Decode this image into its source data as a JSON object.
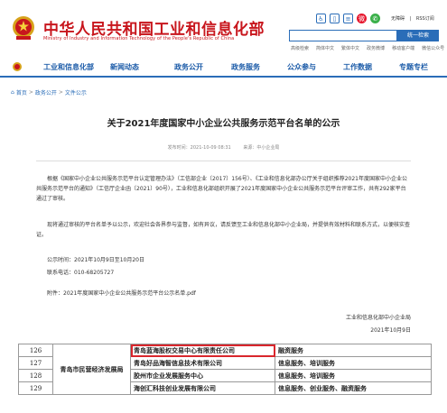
{
  "header": {
    "site_title": "中华人民共和国工业和信息化部",
    "site_subtitle": "Ministry of Industry and Information Technology of the People's Republic of China",
    "top_links": [
      "无障碍",
      "|",
      "RSS订阅"
    ],
    "search_placeholder": "",
    "search_button": "统一检索",
    "quick_links": [
      "高级检索",
      "简体中文",
      "繁体中文",
      "政务微博",
      "移动客户端",
      "微信公众号"
    ],
    "icons": [
      "accessibility-icon",
      "mobile-icon",
      "feed-icon",
      "weibo-icon",
      "wechat-icon"
    ]
  },
  "nav": {
    "items": [
      "工业和信息化部",
      "新闻动态",
      "政务公开",
      "政务服务",
      "公众参与",
      "工作数据",
      "专题专栏"
    ]
  },
  "breadcrumb": [
    "首页",
    ">",
    "政务公开",
    ">",
    "文件公示"
  ],
  "article": {
    "title": "关于2021年度国家中小企业公共服务示范平台名单的公示",
    "publish_time": "发布时间：2021-10-09 08:31",
    "source": "来源：中小企业局",
    "paragraphs": [
      "根据《国家中小企业公共服务示范平台认定管理办法》（工信部企业〔2017〕156号）、《工业和信息化部办公厅关于组织推荐2021年度国家中小企业公共服务示范平台的通知》（工信厅企业函〔2021〕90号），工业和信息化部组织开展了2021年度国家中小企业公共服务示范平台评审工作，共有292家平台通过了审核。",
      "现将通过审核的平台名单予以公示，欢迎社会各界参与监督，如有异议，请反馈至工业和信息化部中小企业局，并提供有效材料和联系方式，以便核实查证。",
      "公示时间：2021年10月9日至10月20日",
      "联系电话：010-68205727",
      "附件：2021年度国家中小企业公共服务示范平台公示名单.pdf"
    ],
    "sign_org": "工业和信息化部中小企业局",
    "sign_date": "2021年10月9日"
  },
  "table": {
    "category": "青岛市民营经济发展局",
    "rows": [
      {
        "num": "126",
        "org": "青岛蓝海股权交易中心有限责任公司",
        "service": "融资服务",
        "highlight": true
      },
      {
        "num": "127",
        "org": "青岛好品海智信息技术有限公司",
        "service": "信息服务、培训服务",
        "highlight": false
      },
      {
        "num": "128",
        "org": "胶州市企业发展服务中心",
        "service": "信息服务、培训服务",
        "highlight": false
      },
      {
        "num": "129",
        "org": "海创汇科技创业发展有限公司",
        "service": "信息服务、创业服务、融资服务",
        "highlight": false
      }
    ]
  },
  "colors": {
    "brand_red": "#c8161d",
    "nav_blue": "#1b5ba8",
    "highlight_red": "#d9262c"
  }
}
